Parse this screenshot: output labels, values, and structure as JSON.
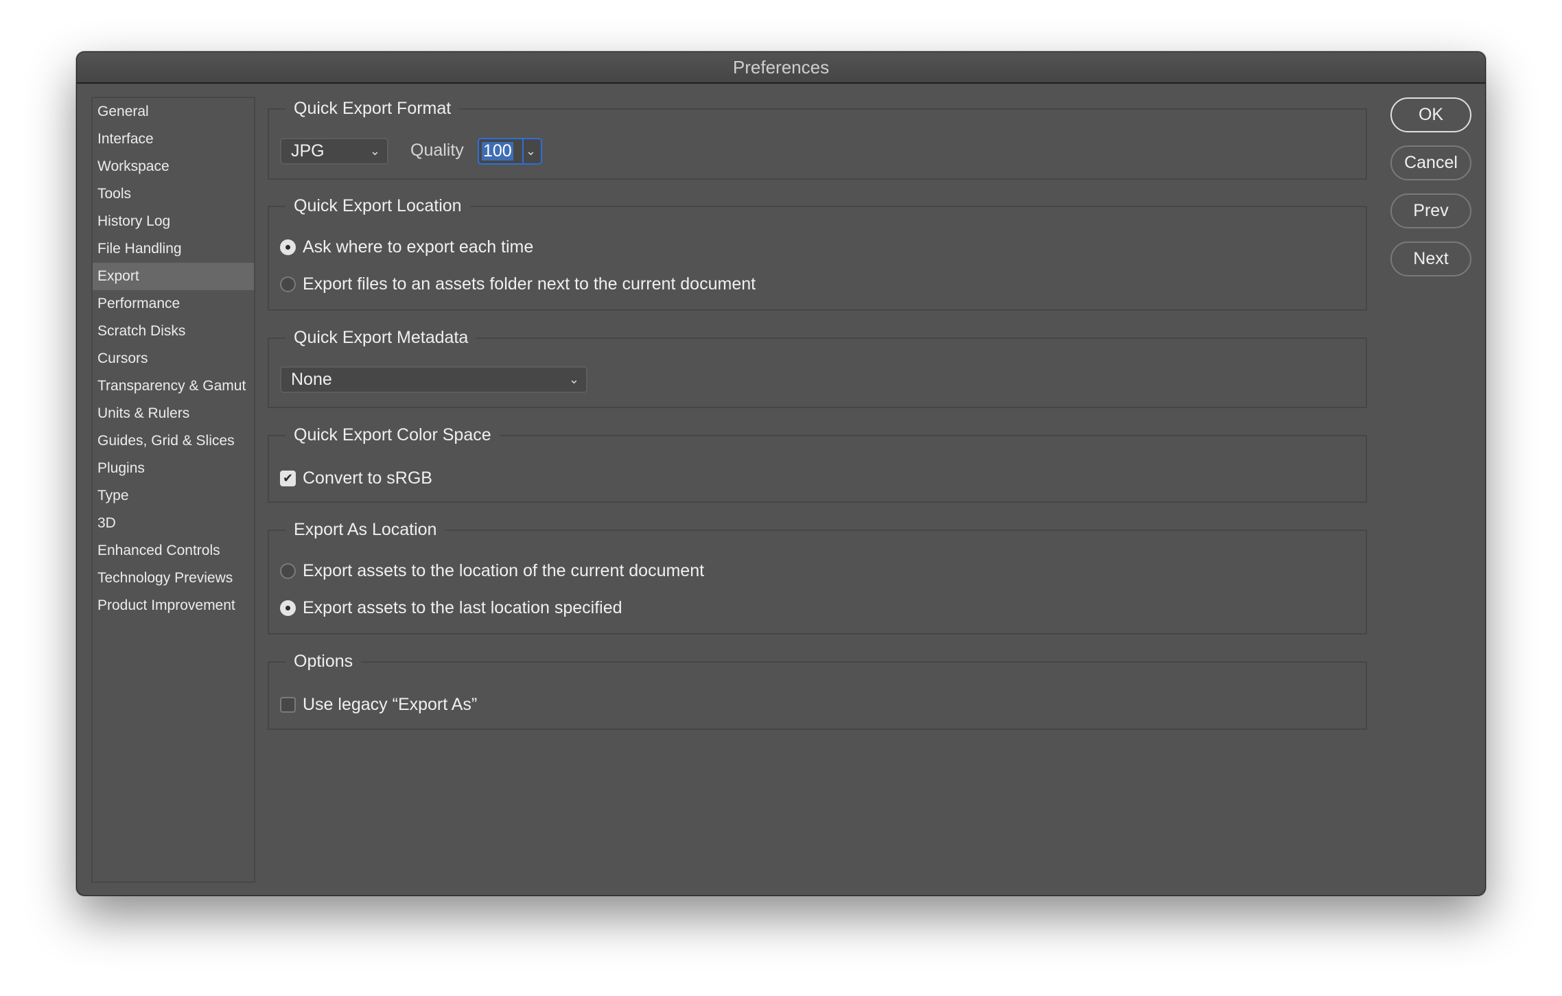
{
  "window": {
    "title": "Preferences"
  },
  "sidebar": {
    "selected_index": 6,
    "items": [
      {
        "label": "General"
      },
      {
        "label": "Interface"
      },
      {
        "label": "Workspace"
      },
      {
        "label": "Tools"
      },
      {
        "label": "History Log"
      },
      {
        "label": "File Handling"
      },
      {
        "label": "Export"
      },
      {
        "label": "Performance"
      },
      {
        "label": "Scratch Disks"
      },
      {
        "label": "Cursors"
      },
      {
        "label": "Transparency & Gamut"
      },
      {
        "label": "Units & Rulers"
      },
      {
        "label": "Guides, Grid & Slices"
      },
      {
        "label": "Plugins"
      },
      {
        "label": "Type"
      },
      {
        "label": "3D"
      },
      {
        "label": "Enhanced Controls"
      },
      {
        "label": "Technology Previews"
      },
      {
        "label": "Product Improvement"
      }
    ]
  },
  "quick_export_format": {
    "legend": "Quick Export Format",
    "format_value": "JPG",
    "quality_label": "Quality",
    "quality_value": "100"
  },
  "quick_export_location": {
    "legend": "Quick Export Location",
    "options": [
      {
        "label": "Ask where to export each time",
        "selected": true
      },
      {
        "label": "Export files to an assets folder next to the current document",
        "selected": false
      }
    ]
  },
  "quick_export_metadata": {
    "legend": "Quick Export Metadata",
    "value": "None"
  },
  "quick_export_color_space": {
    "legend": "Quick Export Color Space",
    "convert_srgb_label": "Convert to sRGB",
    "convert_srgb_checked": true
  },
  "export_as_location": {
    "legend": "Export As Location",
    "options": [
      {
        "label": "Export assets to the location of the current document",
        "selected": false
      },
      {
        "label": "Export assets to the last location specified",
        "selected": true
      }
    ]
  },
  "options": {
    "legend": "Options",
    "legacy_label": "Use legacy “Export As”",
    "legacy_checked": false
  },
  "buttons": {
    "ok": "OK",
    "cancel": "Cancel",
    "prev": "Prev",
    "next": "Next"
  },
  "icons": {
    "chevron": "⌄",
    "check": "✔"
  },
  "colors": {
    "dialog_bg": "#535353",
    "focus_accent": "#2f6fd6",
    "selection": "#3f6db4",
    "sidebar_selected": "#686868"
  }
}
